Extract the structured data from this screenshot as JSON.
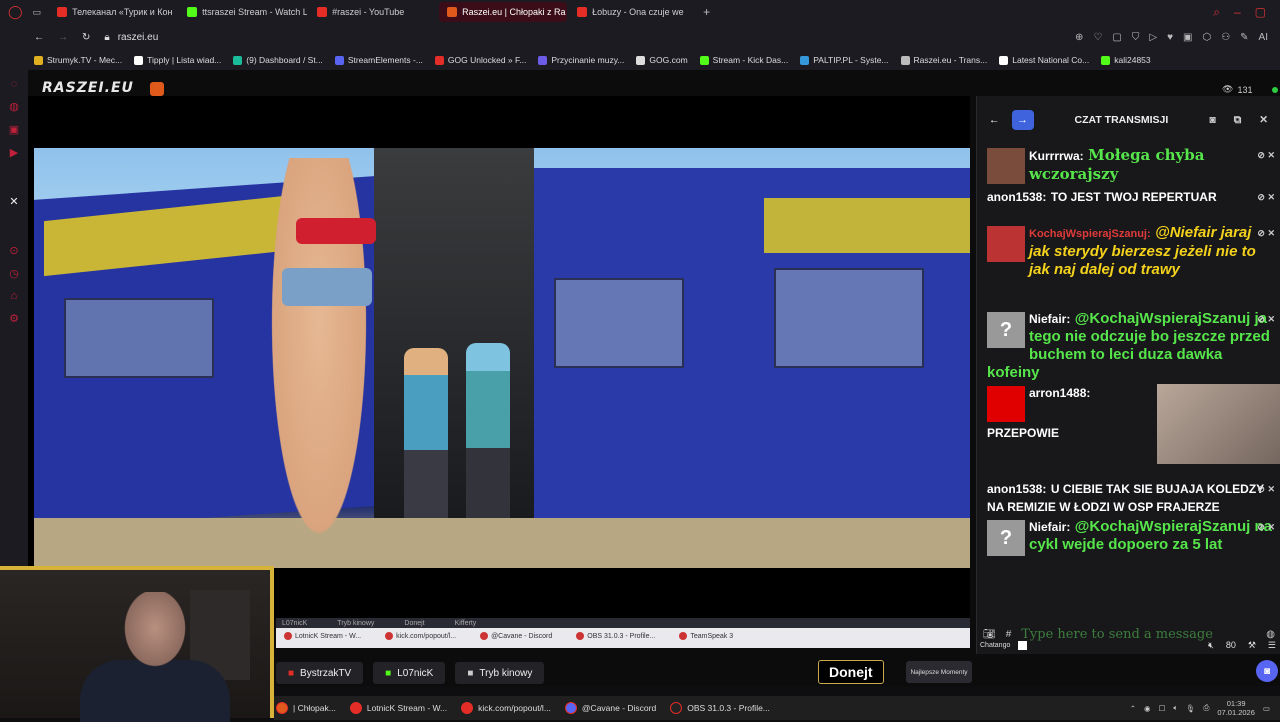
{
  "browser": {
    "tabs": [
      {
        "label": "Телеканал «Турик и Кон",
        "color": "#e52d27",
        "active": false
      },
      {
        "label": "ttsraszei Stream - Watch L",
        "color": "#53fc18",
        "active": false
      },
      {
        "label": "#raszei - YouTube",
        "color": "#e52d27",
        "active": false
      },
      {
        "label": "Raszei.eu | Chłopaki z Ra",
        "color": "#e05a1c",
        "active": true
      },
      {
        "label": "Łobuzy - Ona czuje we",
        "color": "#e52d27",
        "active": false
      }
    ],
    "url": "raszei.eu",
    "bookmarks": [
      {
        "label": "Strumyk.TV - Mec...",
        "color": "#e0b020"
      },
      {
        "label": "Tipply | Lista wiad...",
        "color": "#ffffff"
      },
      {
        "label": "(9) Dashboard / St...",
        "color": "#1abc9c"
      },
      {
        "label": "StreamElements -...",
        "color": "#5865f2"
      },
      {
        "label": "GOG Unlocked » F...",
        "color": "#e52d27"
      },
      {
        "label": "Przycinanie muzy...",
        "color": "#6c5ce7"
      },
      {
        "label": "GOG.com",
        "color": "#dddddd"
      },
      {
        "label": "Stream - Kick Das...",
        "color": "#53fc18"
      },
      {
        "label": "PALTIP.PL - Syste...",
        "color": "#3498db"
      },
      {
        "label": "Raszei.eu - Trans...",
        "color": "#bbbbbb"
      },
      {
        "label": "Latest National Co...",
        "color": "#ffffff"
      },
      {
        "label": "kali24853",
        "color": "#53fc18"
      }
    ],
    "nav_right_label": "AI"
  },
  "site": {
    "logo": "RASZEI.EU",
    "viewers": "131"
  },
  "chat": {
    "title": "CZAT TRANSMISJI",
    "messages": [
      {
        "author": "Kurrrrwa:",
        "text": "Mołega chyba wczorajszy",
        "style": "green-serif",
        "avatar": "#7a4c3c"
      },
      {
        "author": "anon1538:",
        "text": "TO JEST TWOJ REPERTUAR",
        "style": "white",
        "avatar": ""
      },
      {
        "author": "KochajWspierajSzanuj:",
        "text": "@Niefair jaraj jak sterydy bierzesz jeżeli nie to jak naj dalej od trawy",
        "style": "gold",
        "avatar": "#b33"
      },
      {
        "author": "Niefair:",
        "text": "@KochajWspierajSzanuj ja tego nie odczuje bo jeszcze przed buchem to leci duza dawka kofeiny",
        "style": "green",
        "avatar": "#999"
      },
      {
        "author": "arron1488:",
        "text": "PRZEPOWIE",
        "style": "white",
        "avatar": "#e00000"
      },
      {
        "author": "anon1538:",
        "text": "U CIEBIE TAK SIE BUJAJA KOLEDZY NA REMIZIE W ŁODZI W OSP FRAJERZE",
        "style": "white",
        "avatar": ""
      },
      {
        "author": "Niefair:",
        "text": "@KochajWspierajSzanuj na cykl wejde dopoero za 5 lat",
        "style": "green",
        "avatar": "#999"
      }
    ],
    "input_placeholder": "Type here to send a message",
    "footer_label": "Chatango",
    "volume": "80"
  },
  "stream_strip": {
    "tabs": [
      "LotnicK Stream - W...",
      "kick.com/popout/l...",
      "@Cavane - Discord",
      "OBS 31.0.3 - Profile...",
      "TeamSpeak 3"
    ],
    "top_labels": [
      "L07nicK",
      "Tryb kinowy",
      "Donejt",
      "Kifferty"
    ]
  },
  "bottom_bar": {
    "buttons": [
      {
        "label": "BystrzakTV",
        "color": "#e52d27"
      },
      {
        "label": "L07nicK",
        "color": "#53fc18"
      },
      {
        "label": "Tryb kinowy",
        "color": "#cccccc"
      }
    ],
    "donate": "Donejt",
    "moments": "Najlepsze Momenty"
  },
  "taskbar": {
    "items": [
      {
        "label": "| Chłopak...",
        "color": "#e05a1c"
      },
      {
        "label": "LotnicK Stream - W...",
        "color": "#e52d27"
      },
      {
        "label": "kick.com/popout/l...",
        "color": "#e52d27"
      },
      {
        "label": "@Cavane - Discord",
        "color": "#5865f2"
      },
      {
        "label": "OBS 31.0.3 - Profile...",
        "color": "#222222"
      }
    ],
    "time": "01:39",
    "date": "07.01.2026"
  }
}
